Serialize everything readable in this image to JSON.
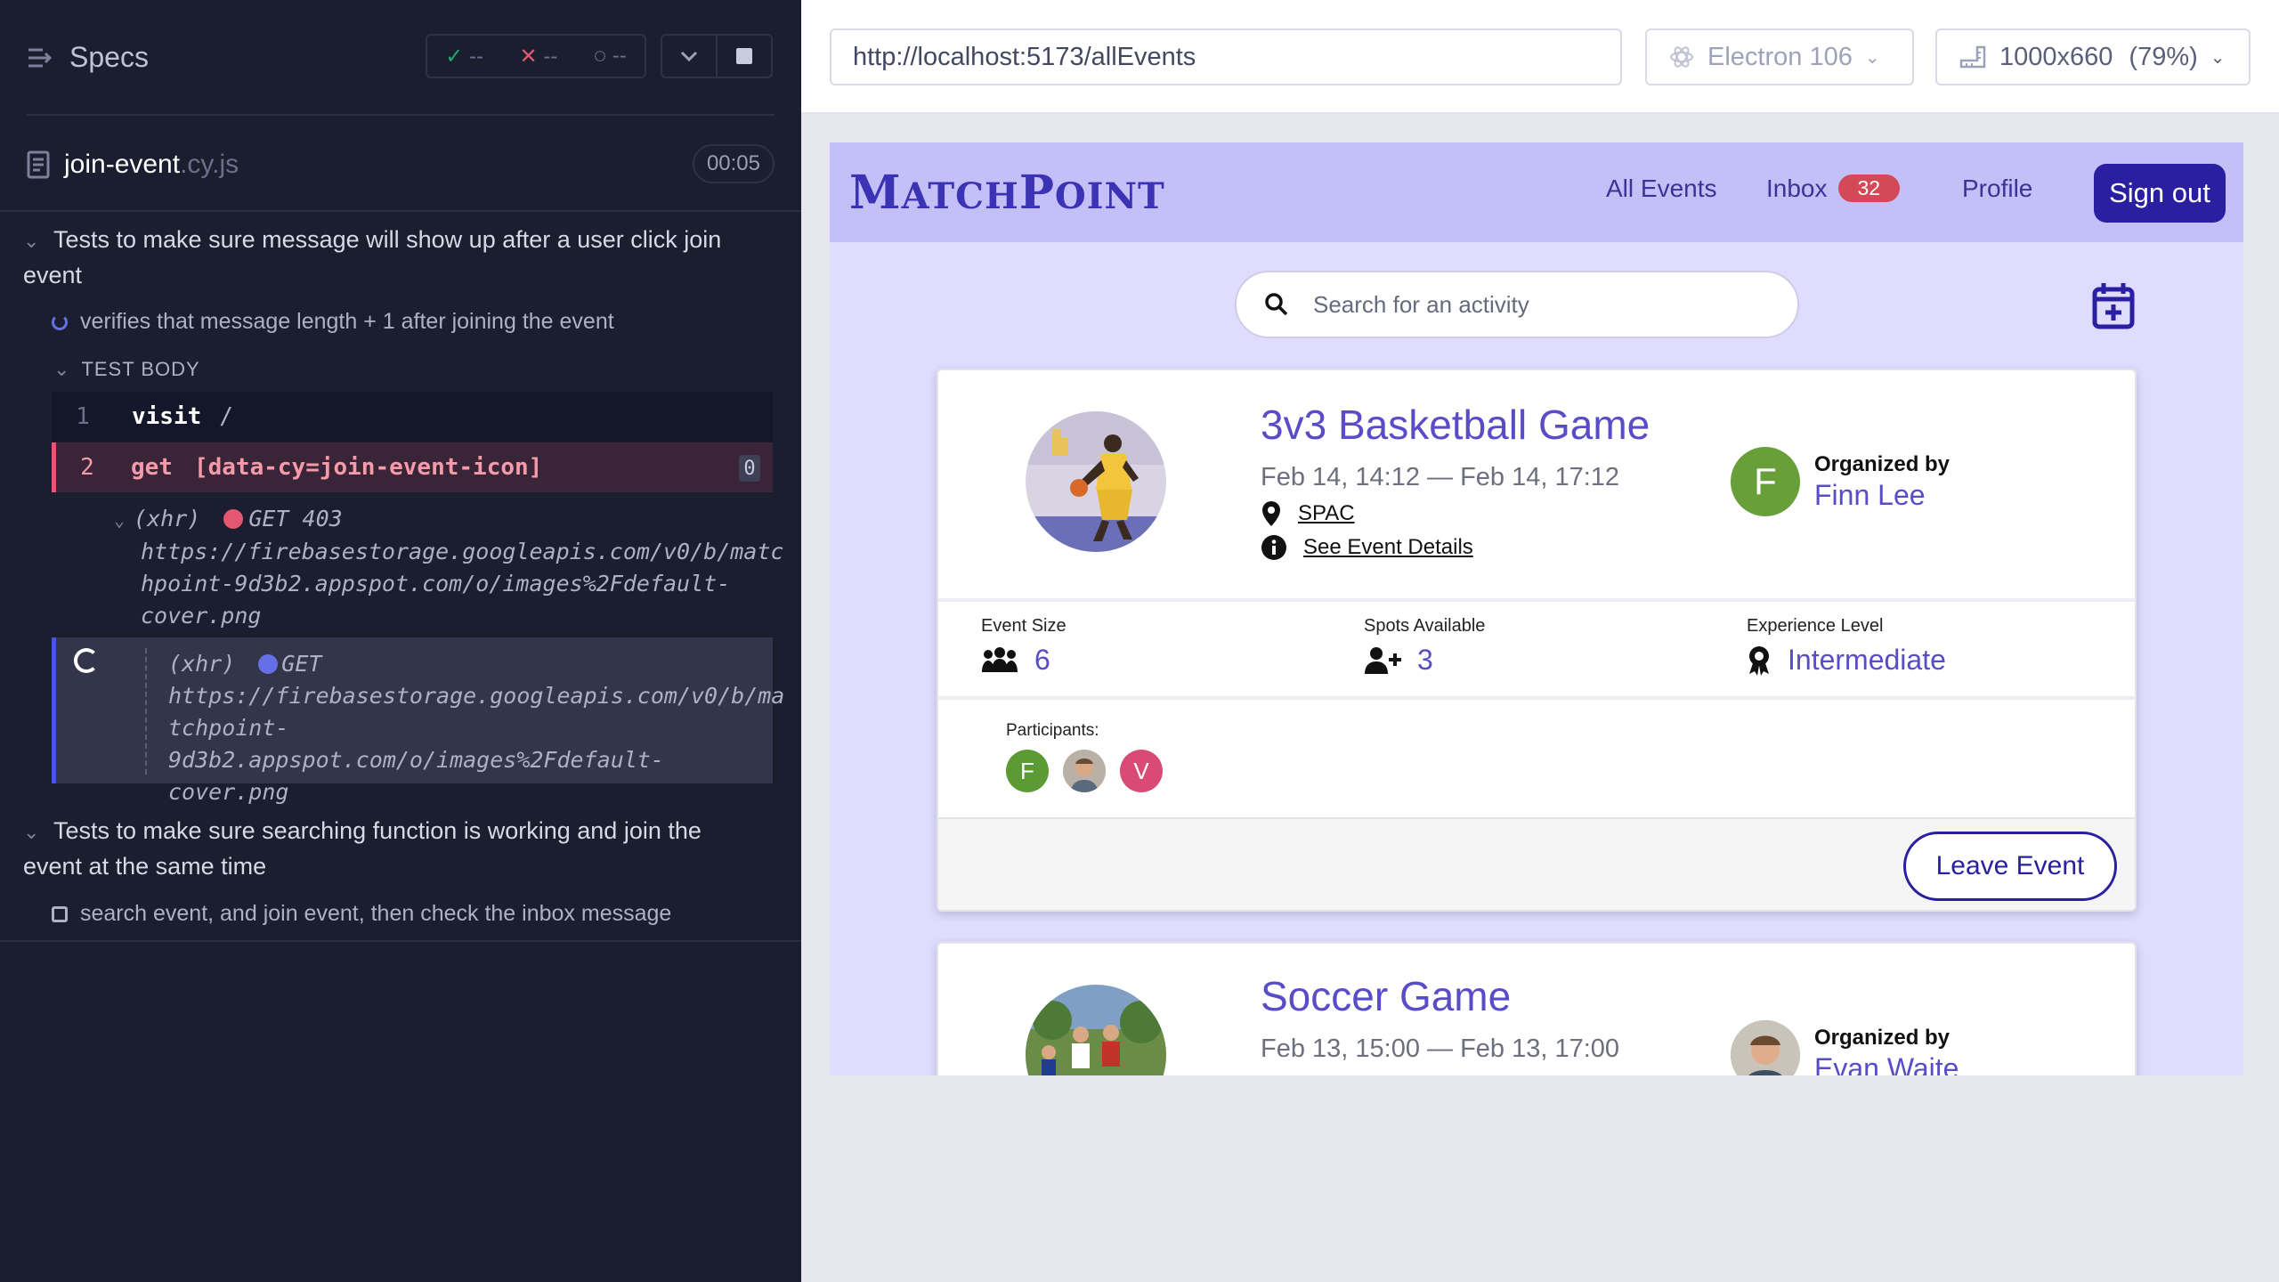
{
  "runner": {
    "title": "Specs",
    "stats": {
      "passed": "--",
      "failed": "--",
      "pending": "--"
    },
    "spec": {
      "name": "join-event",
      "ext": ".cy.js",
      "time": "00:05"
    },
    "suites": [
      {
        "title": "Tests to make sure message will show up after a user click join event",
        "test": "verifies that message length + 1 after joining the event"
      },
      {
        "title": "Tests to make sure searching function is working and join the event at the same time",
        "test": "search event, and join event, then check the inbox message"
      }
    ],
    "test_body_label": "TEST BODY",
    "commands": [
      {
        "num": "1",
        "name": "visit",
        "arg": "/"
      },
      {
        "num": "2",
        "name": "get",
        "arg": "[data-cy=join-event-icon]",
        "badge": "0"
      }
    ],
    "xhr1": {
      "label": "(xhr)",
      "method": "GET 403",
      "url_lines": [
        "https://firebasestorage.googleapis.com/v0/b/matc",
        "hpoint-9d3b2.appspot.com/o/images%2Fdefault-",
        "cover.png"
      ]
    },
    "xhr2": {
      "label": "(xhr)",
      "method": "GET",
      "url_lines": [
        "https://firebasestorage.googleapis.com/v0/b/ma",
        "tchpoint-9d3b2.appspot.com/o/images%2Fdefault-",
        "cover.png"
      ]
    }
  },
  "toolbar": {
    "url": "http://localhost:5173/allEvents",
    "browser": "Electron 106",
    "viewport": "1000x660",
    "zoom": "(79%)"
  },
  "app": {
    "logo": {
      "m": "M",
      "atch": "ATCH",
      "p": "P",
      "oint": "OINT"
    },
    "nav": {
      "all_events": "All Events",
      "inbox": "Inbox",
      "inbox_count": "32",
      "profile": "Profile",
      "sign_out": "Sign out"
    },
    "search_placeholder": "Search for an activity",
    "events": [
      {
        "title": "3v3 Basketball Game",
        "time": "Feb 14, 14:12 — Feb 14, 17:12",
        "location": "SPAC",
        "details_link": "See Event Details",
        "organized_by_label": "Organized by",
        "organizer": "Finn Lee",
        "organizer_initial": "F",
        "stats": [
          {
            "label": "Event Size",
            "value": "6",
            "icon": "group-icon"
          },
          {
            "label": "Spots Available",
            "value": "3",
            "icon": "user-plus-icon"
          },
          {
            "label": "Experience Level",
            "value": "Intermediate",
            "icon": "award-icon"
          }
        ],
        "participants_label": "Participants:",
        "participants": [
          "F",
          "photo",
          "V"
        ],
        "action": "Leave Event"
      },
      {
        "title": "Soccer Game",
        "time": "Feb 13, 15:00 — Feb 13, 17:00",
        "organized_by_label": "Organized by",
        "organizer": "Evan Waite"
      }
    ]
  },
  "colors": {
    "accent": "#5a4cc7",
    "brand_dark": "#2a1fa0",
    "navbar": "#c3c0f8",
    "page_bg": "#e0dcff",
    "fail": "#e45770",
    "running": "#6570e6"
  }
}
